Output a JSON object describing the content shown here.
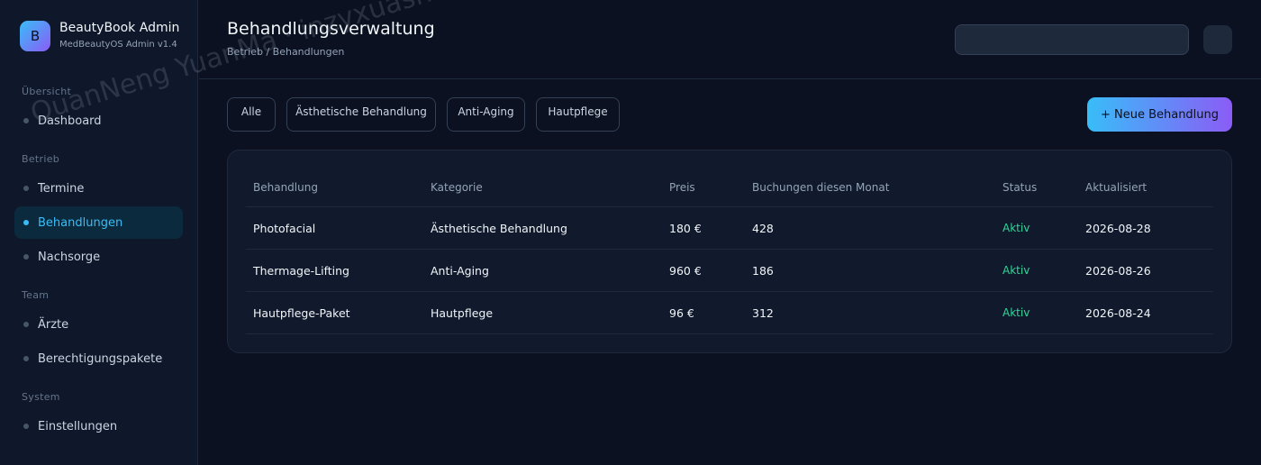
{
  "brand": {
    "logo_letter": "B",
    "name": "BeautyBook Admin",
    "subtitle": "MedBeautyOS Admin v1.4"
  },
  "sidebar": {
    "sections": [
      "Übersicht",
      "Betrieb",
      "Team",
      "System"
    ],
    "items": [
      {
        "label": "Dashboard"
      },
      {
        "label": "Termine"
      },
      {
        "label": "Behandlungen",
        "active": true
      },
      {
        "label": "Nachsorge"
      },
      {
        "label": "Ärzte"
      },
      {
        "label": "Berechtigungspakete"
      },
      {
        "label": "Einstellungen"
      }
    ]
  },
  "header": {
    "title": "Behandlungsverwaltung",
    "breadcrumb": "Betrieb / Behandlungen"
  },
  "filters": [
    "Alle",
    "Ästhetische Behandlung",
    "Anti-Aging",
    "Hautpflege"
  ],
  "actions": {
    "new_label": "+ Neue Behandlung"
  },
  "table": {
    "columns": [
      "Behandlung",
      "Kategorie",
      "Preis",
      "Buchungen diesen Monat",
      "Status",
      "Aktualisiert"
    ],
    "rows": [
      [
        "Photofacial",
        "Ästhetische Behandlung",
        "180 €",
        "428",
        "Aktiv",
        "2026-08-28"
      ],
      [
        "Thermage-Lifting",
        "Anti-Aging",
        "960 €",
        "186",
        "Aktiv",
        "2026-08-26"
      ],
      [
        "Hautpflege-Paket",
        "Hautpflege",
        "96 €",
        "312",
        "Aktiv",
        "2026-08-24"
      ]
    ]
  },
  "watermark": "QuanNeng YuanMa · inzyxuashop.com",
  "colors": {
    "accent": "#38bdf8",
    "accent_end": "#8b5cf6",
    "status_active": "#34d399",
    "background": "#0b1120"
  }
}
